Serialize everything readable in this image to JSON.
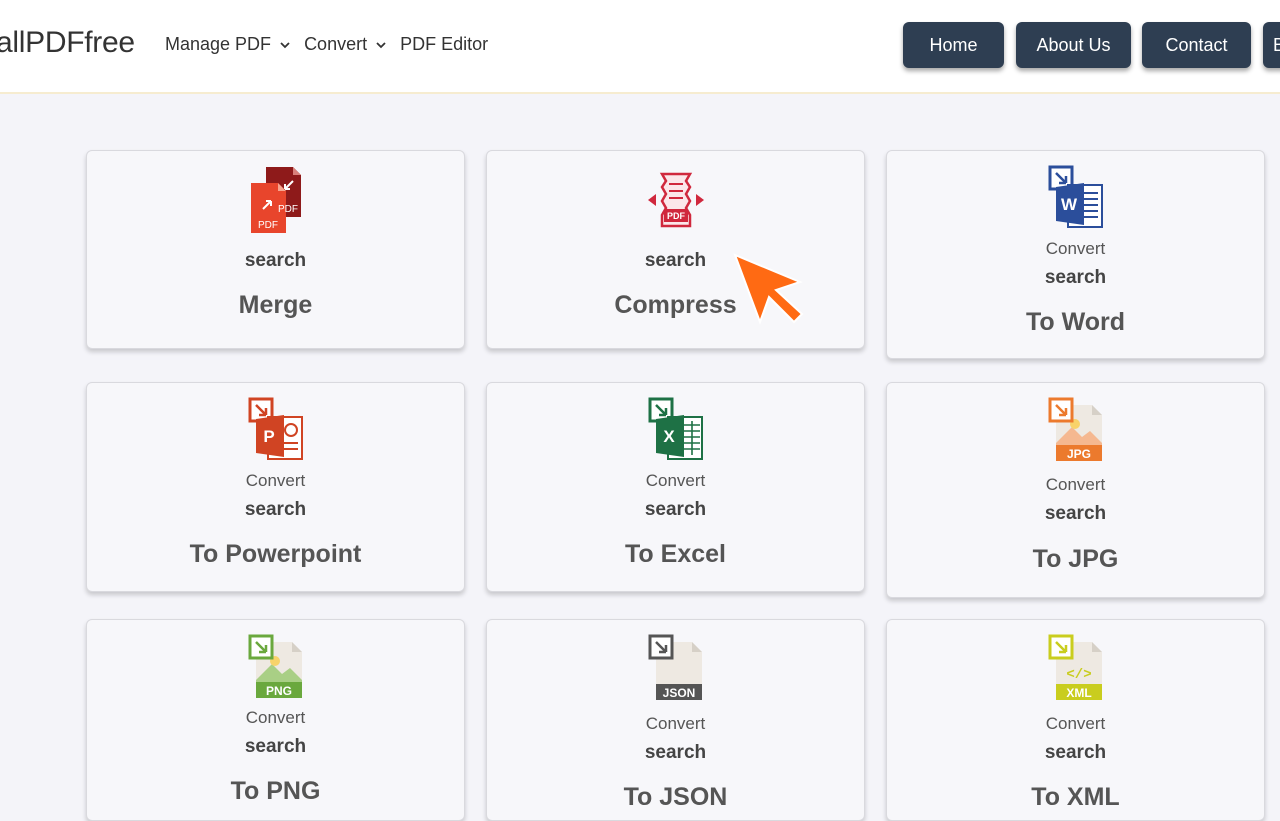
{
  "header": {
    "logo": "allPDFfree",
    "nav": [
      {
        "label": "Manage PDF",
        "has_dropdown": true
      },
      {
        "label": "Convert",
        "has_dropdown": true
      },
      {
        "label": "PDF Editor",
        "has_dropdown": false
      }
    ],
    "buttons": {
      "home": "Home",
      "about": "About Us",
      "contact": "Contact",
      "partial": "B"
    }
  },
  "colors": {
    "header_button": "#2e3e52",
    "cursor": "#ff6a13",
    "page_bg": "#f4f4f9"
  },
  "cards": [
    {
      "icon": "merge-pdf-icon",
      "convert": "",
      "search": "search",
      "title": "Merge"
    },
    {
      "icon": "compress-pdf-icon",
      "convert": "",
      "search": "search",
      "title": "Compress"
    },
    {
      "icon": "word-icon",
      "convert": "Convert",
      "search": "search",
      "title": "To Word"
    },
    {
      "icon": "powerpoint-icon",
      "convert": "Convert",
      "search": "search",
      "title": "To Powerpoint"
    },
    {
      "icon": "excel-icon",
      "convert": "Convert",
      "search": "search",
      "title": "To Excel"
    },
    {
      "icon": "jpg-icon",
      "convert": "Convert",
      "search": "search",
      "title": "To JPG"
    },
    {
      "icon": "png-icon",
      "convert": "Convert",
      "search": "search",
      "title": "To PNG"
    },
    {
      "icon": "json-icon",
      "convert": "Convert",
      "search": "search",
      "title": "To JSON"
    },
    {
      "icon": "xml-icon",
      "convert": "Convert",
      "search": "search",
      "title": "To XML"
    }
  ],
  "icon_labels": {
    "pdf": "PDF",
    "word": "W",
    "powerpoint": "P",
    "excel": "X",
    "jpg": "JPG",
    "png": "PNG",
    "json": "JSON",
    "xml": "XML",
    "code": "</>"
  }
}
